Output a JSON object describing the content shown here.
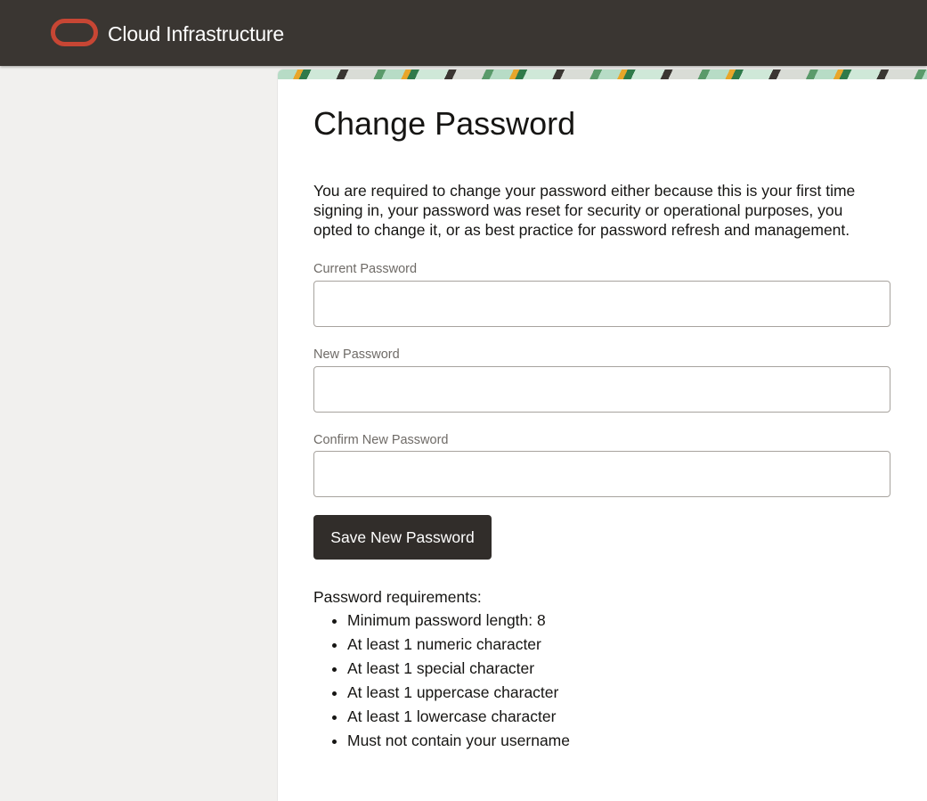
{
  "header": {
    "brand_name": "Cloud Infrastructure",
    "logo_icon": "oracle-logo-icon",
    "logo_color": "#c74634",
    "bar_color": "#3a3632"
  },
  "main": {
    "title": "Change Password",
    "intro": "You are required to change your password either because this is your first time signing in, your password was reset for security or operational purposes, you opted to change it, or as best practice for password refresh and management.",
    "fields": [
      {
        "label": "Current Password",
        "value": "",
        "placeholder": ""
      },
      {
        "label": "New Password",
        "value": "",
        "placeholder": ""
      },
      {
        "label": "Confirm New Password",
        "value": "",
        "placeholder": ""
      }
    ],
    "save_label": "Save New Password",
    "requirements_title": "Password requirements:",
    "requirements": [
      "Minimum password length: 8",
      "At least 1 numeric character",
      "At least 1 special character",
      "At least 1 uppercase character",
      "At least 1 lowercase character",
      "Must not contain your username"
    ]
  }
}
